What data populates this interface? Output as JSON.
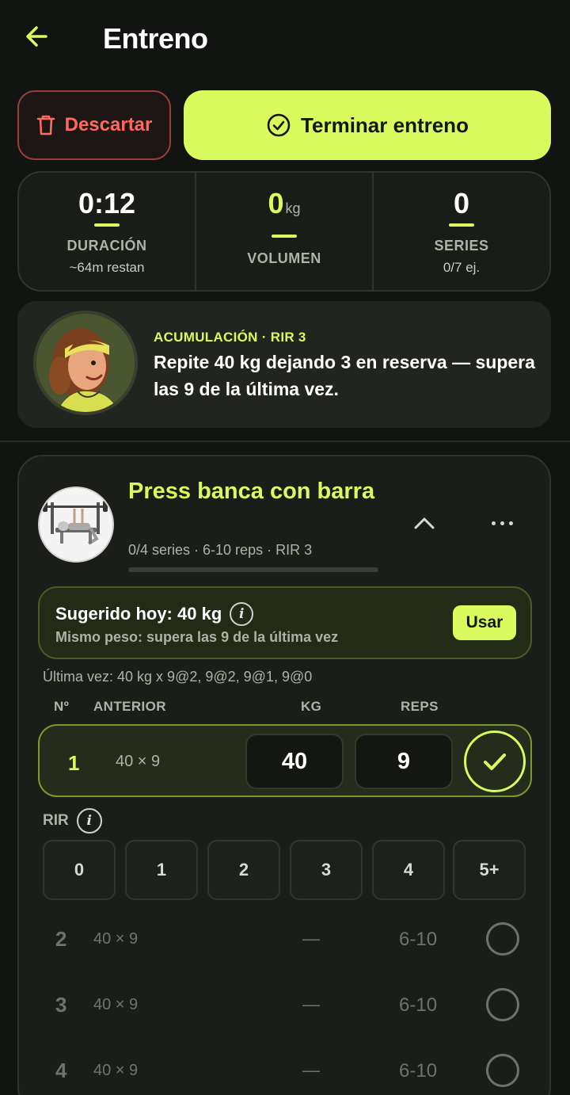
{
  "header": {
    "title": "Entreno",
    "back_icon": "arrow-left-icon"
  },
  "actions": {
    "discard_label": "Descartar",
    "finish_label": "Terminar entreno"
  },
  "stats": {
    "duration": {
      "value": "0:12",
      "label": "DURACIÓN",
      "sub": "~64m restan"
    },
    "volume": {
      "value": "0",
      "unit": "kg",
      "label": "VOLUMEN"
    },
    "series": {
      "value": "0",
      "label": "SERIES",
      "sub": "0/7 ej."
    }
  },
  "coach": {
    "tag": "ACUMULACIÓN · RIR 3",
    "message": "Repite 40 kg dejando 3 en reserva — supera las 9 de la última vez."
  },
  "exercise": {
    "name": "Press banca con barra",
    "meta": "0/4 series · 6-10 reps · RIR 3",
    "progress": 0,
    "suggestion": {
      "title": "Sugerido hoy: 40 kg",
      "subtitle": "Mismo peso: supera las 9 de la última vez",
      "use_label": "Usar"
    },
    "last_time": "Última vez: 40 kg x 9@2, 9@2, 9@1, 9@0",
    "headers": {
      "num": "Nº",
      "previous": "ANTERIOR",
      "kg": "KG",
      "reps": "REPS"
    },
    "active_set": {
      "num": "1",
      "previous": "40 × 9",
      "kg": "40",
      "reps": "9"
    },
    "rir": {
      "label": "RIR",
      "options": [
        "0",
        "1",
        "2",
        "3",
        "4",
        "5+"
      ]
    },
    "pending_sets": [
      {
        "num": "2",
        "previous": "40 × 9",
        "kg": "—",
        "reps": "6-10"
      },
      {
        "num": "3",
        "previous": "40 × 9",
        "kg": "—",
        "reps": "6-10"
      },
      {
        "num": "4",
        "previous": "40 × 9",
        "kg": "—",
        "reps": "6-10"
      }
    ]
  },
  "colors": {
    "accent": "#d9fb5e",
    "danger": "#ff6a5e",
    "background": "#121411"
  }
}
